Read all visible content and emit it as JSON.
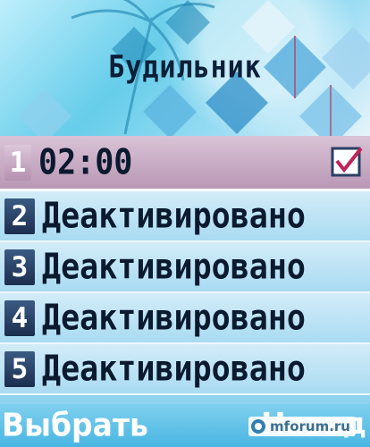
{
  "header": {
    "title": "Будильник"
  },
  "alarms": [
    {
      "index": "1",
      "label": "02:00",
      "selected": true,
      "checked": true
    },
    {
      "index": "2",
      "label": "Деактивировано",
      "selected": false
    },
    {
      "index": "3",
      "label": "Деактивировано",
      "selected": false
    },
    {
      "index": "4",
      "label": "Деактивировано",
      "selected": false
    },
    {
      "index": "5",
      "label": "Деактивировано",
      "selected": false
    }
  ],
  "softkeys": {
    "left": "Выбрать",
    "right": "Назад"
  },
  "watermark": "mforum.ru",
  "colors": {
    "selected_row": "#b997b5",
    "row": "#a9dbf2",
    "number_badge": "#1b2e4e",
    "softkey_bar": "#49b6e2"
  },
  "icons": {
    "checkbox": "checkbox-checked-icon"
  }
}
